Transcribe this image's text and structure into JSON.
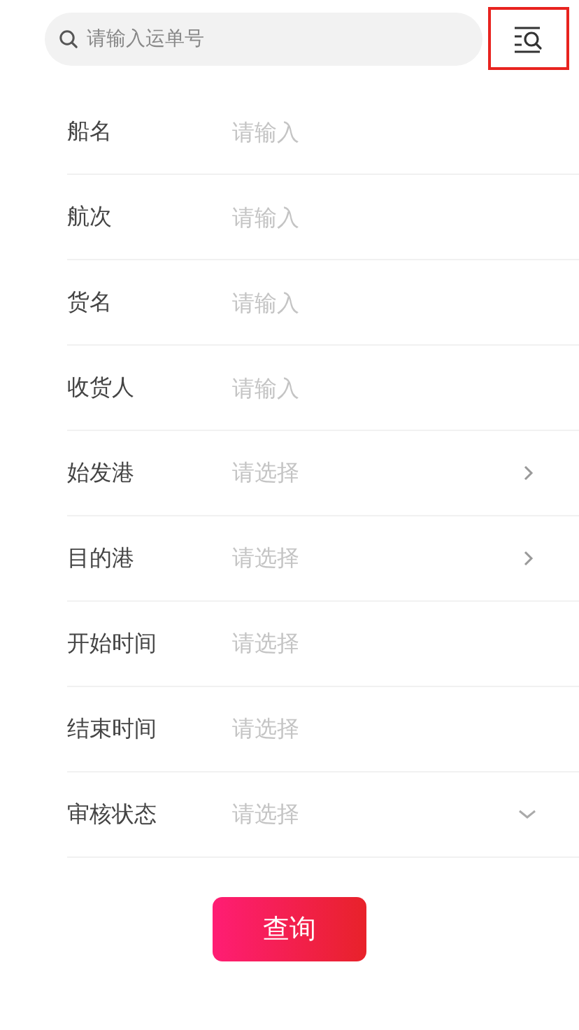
{
  "search": {
    "placeholder": "请输入运单号"
  },
  "filter_button": {
    "highlighted": true
  },
  "fields": [
    {
      "label": "船名",
      "placeholder": "请输入",
      "kind": "text"
    },
    {
      "label": "航次",
      "placeholder": "请输入",
      "kind": "text"
    },
    {
      "label": "货名",
      "placeholder": "请输入",
      "kind": "text"
    },
    {
      "label": "收货人",
      "placeholder": "请输入",
      "kind": "text"
    },
    {
      "label": "始发港",
      "placeholder": "请选择",
      "kind": "picker"
    },
    {
      "label": "目的港",
      "placeholder": "请选择",
      "kind": "picker"
    },
    {
      "label": "开始时间",
      "placeholder": "请选择",
      "kind": "date"
    },
    {
      "label": "结束时间",
      "placeholder": "请选择",
      "kind": "date"
    },
    {
      "label": "审核状态",
      "placeholder": "请选择",
      "kind": "dropdown"
    }
  ],
  "submit": "查询"
}
